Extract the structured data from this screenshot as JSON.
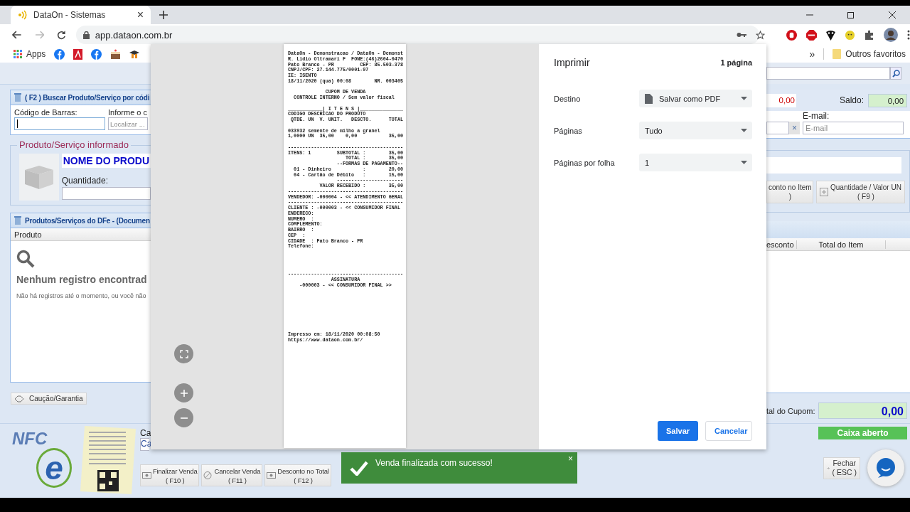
{
  "browser": {
    "tab_title": "DataOn - Sistemas",
    "tab_close": "×",
    "url": "app.dataon.com.br",
    "bookmarks": [
      {
        "label": "Apps"
      }
    ],
    "bookmark_overflow": "»",
    "other_bookmarks": "Outros favoritos"
  },
  "app": {
    "search_panel": {
      "title": "( F2 ) Buscar Produto/Serviço por códi",
      "barcode_label": "Código de Barras:",
      "find_label": "Informe o c",
      "find_placeholder": "Localizar ..."
    },
    "product": {
      "legend": "Produto/Serviço informado",
      "name": "NOME DO PRODU",
      "quantity_label": "Quantidade:"
    },
    "items_panel": {
      "title": "Produtos/Serviços do DFe - (Documen",
      "column_left": "Produto",
      "empty_title": "Nenhum registro encontrad",
      "empty_text": "Não há registros até o momento, ou você não",
      "columns_right": [
        "esconto",
        "Total do Item"
      ]
    },
    "deposit_button": "Caução/Garantia",
    "right": {
      "amount": "0,00",
      "balance_label": "Saldo:",
      "balance": "0,00",
      "email_label": "E-mail:",
      "email_placeholder": "E-mail",
      "clear": "×",
      "buttons": [
        {
          "label": "conto no Item",
          "key": ")",
          "kind": "plain"
        },
        {
          "label": "Quantidade / Valor UN",
          "key": "( F9 )",
          "kind": "plus"
        }
      ],
      "total_label": "tal do Cupom:",
      "total": "0,00",
      "status": "Caixa aberto"
    },
    "nfce": {
      "logo": "NFC",
      "logo_e": "e"
    },
    "cash_label": "Ca",
    "cash_value": "Ca",
    "toolbar": [
      {
        "label": "Finalizar Venda",
        "key": "( F10 )"
      },
      {
        "label": "Cancelar Venda",
        "key": "( F11 )"
      },
      {
        "label": "Desconto no Total",
        "key": "( F12 )"
      }
    ],
    "close_button": {
      "label": "Fechar",
      "key": "( ESC )"
    }
  },
  "toast": {
    "message": "Venda finalizada com sucesso!",
    "close": "×"
  },
  "print_dialog": {
    "title": "Imprimir",
    "page_count": "1 página",
    "settings": [
      {
        "label": "Destino",
        "value": "Salvar como PDF",
        "has_icon": true
      },
      {
        "label": "Páginas",
        "value": "Tudo",
        "has_icon": false
      },
      {
        "label": "Páginas por folha",
        "value": "1",
        "has_icon": false
      }
    ],
    "buttons": [
      {
        "label": "Salvar",
        "kind": "primary"
      },
      {
        "label": "Cancelar",
        "kind": "secondary"
      }
    ],
    "receipt": [
      [
        "DataOn - Demonstracao / DataOn - Demonst",
        "R. Lidio Oltramari F  FONE:(46)2604-0470",
        "Pato Branco - PR         CEP: 85.503-378",
        "CNPJ/CPF: 27.144.775/0001-97",
        "IE: ISENTO",
        "18/11/2020 (qua) 00:08        NR. 003405"
      ],
      [
        "             CUPOM DE VENDA",
        "  CONTROLE INTERNO / Sem valor fiscal"
      ],
      [
        "____________| I T E N S |_______________",
        "CODIGO DESCRICAO DO PRODUTO",
        " QTDE. UN  V. UNIT.   DESCTO.      TOTAL"
      ],
      [
        "033932 semente de milho a granel",
        "1,0000 UN  35,00    0,00           35,00"
      ],
      [
        "----------------------------------------",
        "ITENS: 1         SUBTOTAL :        35,00",
        "                    TOTAL :        35,00",
        "                 --FORMAS DE PAGAMENTO--",
        "  01 - Dinheiro           :        20,00",
        "  04 - Cartão de Débito   :        15,00",
        "                 -----------------------",
        "           VALOR RECEBIDO :        35,00",
        "----------------------------------------",
        "VENDEDOR: -000004 - << ATENDIMENTO GERAL",
        "----------------------------------------",
        "CLIENTE : -000003 - << CONSUMIDOR FINAL",
        "ENDERECO:",
        "NUMERO  :",
        "COMPLEMENTO:",
        "BAIRRO  :",
        "CEP  :",
        "CIDADE  : Pato Branco - PR",
        "Telefone:"
      ],
      [
        "----------------------------------------",
        "               ASSINATURA",
        "    -000003 - << CONSUMIDOR FINAL >>"
      ],
      [
        "Impresso em: 18/11/2020 00:08:50",
        "https://www.dataon.com.br/"
      ]
    ]
  }
}
